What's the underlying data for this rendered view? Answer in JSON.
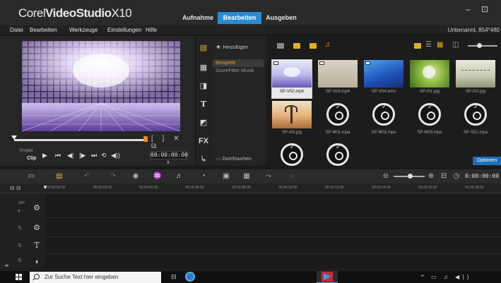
{
  "window": {
    "app_title_light": "Corel",
    "app_title_bold": "VideoStudio",
    "app_title_version": "X10",
    "steps": [
      "Aufnahme",
      "Bearbeiten",
      "Ausgeben"
    ],
    "active_step": "Bearbeiten",
    "controls": "– ⊡"
  },
  "menu": {
    "items": [
      "Datei",
      "Bearbeiten",
      "Werkzeuge",
      "Einstellungen",
      "Hilfe"
    ],
    "project_name": "Unbenannt, 854*480"
  },
  "player": {
    "mode_project": "Projekt",
    "mode_clip": "Clip",
    "transport": [
      "▶",
      "⏮",
      "◀|",
      "|▶",
      "⏭",
      "⟲",
      "◀))"
    ],
    "timecode": "00:00:00:00 ⇕",
    "mark_controls": "[ ] ✕ ⧉"
  },
  "library": {
    "add_label": "Hinzufügen",
    "folders": [
      {
        "label": "Beispiele",
        "active": true
      },
      {
        "label": "ScoreFitter Musik",
        "active": false
      }
    ],
    "browse_label": "Durchsuchen",
    "options_label": "Optionen",
    "items": [
      {
        "label": "SP-V02.mp4",
        "kind": "video-sky",
        "selected": true,
        "badge": true
      },
      {
        "label": "SP-V03.mp4",
        "kind": "video-sand",
        "selected": false,
        "badge": true
      },
      {
        "label": "SP-V04.wmv",
        "kind": "video-blue",
        "selected": false,
        "badge": true
      },
      {
        "label": "SP-I01.jpg",
        "kind": "photo-dandelion",
        "selected": false,
        "badge": false
      },
      {
        "label": "SP-I02.jpg",
        "kind": "photo-field",
        "selected": false,
        "badge": false
      },
      {
        "label": "SP-I03.jpg",
        "kind": "photo-tree",
        "selected": false,
        "badge": false
      },
      {
        "label": "SP-M01.mpa",
        "kind": "audio",
        "selected": false,
        "badge": false
      },
      {
        "label": "SP-M02.mpa",
        "kind": "audio",
        "selected": false,
        "badge": false
      },
      {
        "label": "SP-M03.mpa",
        "kind": "audio",
        "selected": false,
        "badge": false
      },
      {
        "label": "SP-S01.mpa",
        "kind": "audio",
        "selected": false,
        "badge": false
      },
      {
        "label": "",
        "kind": "audio",
        "selected": false,
        "badge": false
      },
      {
        "label": "",
        "kind": "audio",
        "selected": false,
        "badge": false
      }
    ]
  },
  "timeline": {
    "duration": "0:00:00:00",
    "ruler": [
      "00:00:00:00",
      "00:00:02:00",
      "00:00:04:00",
      "00:00:06:00",
      "00:00:08:00",
      "00:00:10:00",
      "00:00:12:00",
      "00:00:14:00",
      "00:00:16:00",
      "00:00:18:00"
    ]
  },
  "taskbar": {
    "search_placeholder": "Zur Suche Text hier eingeben",
    "tray": "^ ▭ ♫ ◀))"
  },
  "colors": {
    "accent": "#2a8ad2",
    "active_folder": "#f0a020",
    "scrubber_end": "#f08a1c"
  }
}
